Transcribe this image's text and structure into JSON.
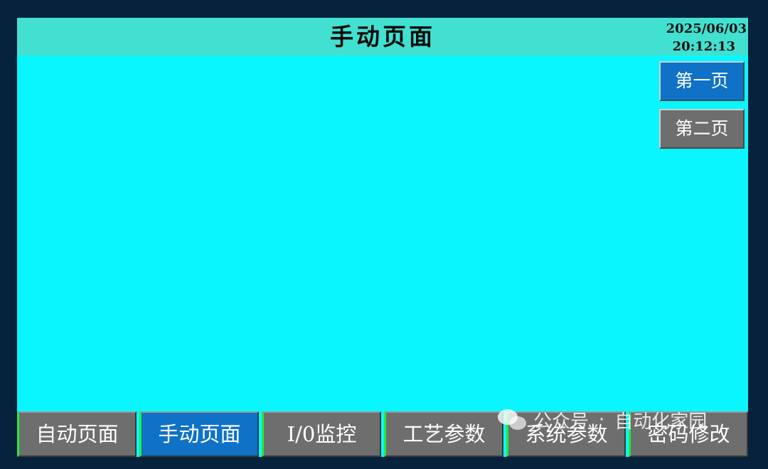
{
  "header": {
    "title": "手动页面",
    "date": "2025/06/03",
    "time": "20:12:13"
  },
  "side_buttons": [
    {
      "label": "第一页",
      "active": true
    },
    {
      "label": "第二页",
      "active": false
    }
  ],
  "nav": [
    {
      "label": "自动页面",
      "active": false
    },
    {
      "label": "手动页面",
      "active": true
    },
    {
      "label": "I/0监控",
      "active": false
    },
    {
      "label": "工艺参数",
      "active": false
    },
    {
      "label": "系统参数",
      "active": false
    },
    {
      "label": "密码修改",
      "active": false
    }
  ],
  "watermark": {
    "account_label": "公众号",
    "separator": "·",
    "name": "自动化家园",
    "icon": "wechat-icon"
  },
  "colors": {
    "background": "#0af6ff",
    "header": "#42e0d0",
    "button_active": "#0f72c7",
    "button_inactive": "#6e6e6e",
    "nav_accent": "#27e83c",
    "frame": "#06223d"
  }
}
